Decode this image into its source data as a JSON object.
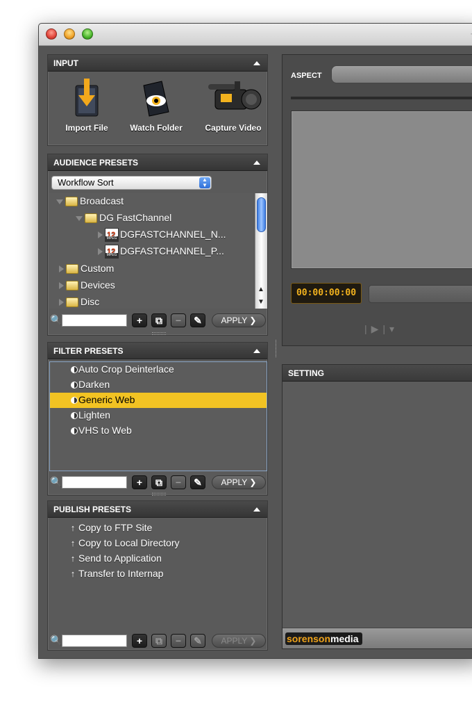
{
  "input": {
    "title": "INPUT",
    "items": [
      {
        "label": "Import File",
        "icon": "import-file-icon"
      },
      {
        "label": "Watch Folder",
        "icon": "watch-folder-icon"
      },
      {
        "label": "Capture Video",
        "icon": "capture-video-icon"
      }
    ]
  },
  "audience": {
    "title": "AUDIENCE PRESETS",
    "sort": "Workflow Sort",
    "tree": [
      {
        "label": "Broadcast"
      },
      {
        "label": "DG FastChannel"
      },
      {
        "label": "DGFASTCHANNEL_N...",
        "badge": "12"
      },
      {
        "label": "DGFASTCHANNEL_P...",
        "badge": "12"
      },
      {
        "label": "Custom"
      },
      {
        "label": "Devices"
      },
      {
        "label": "Disc"
      }
    ],
    "apply": "APPLY ❯"
  },
  "filter": {
    "title": "FILTER PRESETS",
    "items": [
      "Auto Crop Deinterlace",
      "Darken",
      "Generic Web",
      "Lighten",
      "VHS to Web"
    ],
    "selected": "Generic Web",
    "apply": "APPLY ❯"
  },
  "publish": {
    "title": "PUBLISH PRESETS",
    "items": [
      "Copy to FTP Site",
      "Copy to Local Directory",
      "Send to Application",
      "Transfer to Internap"
    ],
    "apply": "APPLY ❯"
  },
  "preview": {
    "aspect_label": "ASPECT",
    "timecode": "00:00:00:00"
  },
  "setting": {
    "title": "SETTING",
    "brand_a": "sorenson",
    "brand_b": "media"
  },
  "colors": {
    "selection": "#f2c323",
    "timecode": "#f2b21e",
    "brand_accent": "#f0a31a",
    "scroll_thumb": "#3f7ee3"
  }
}
